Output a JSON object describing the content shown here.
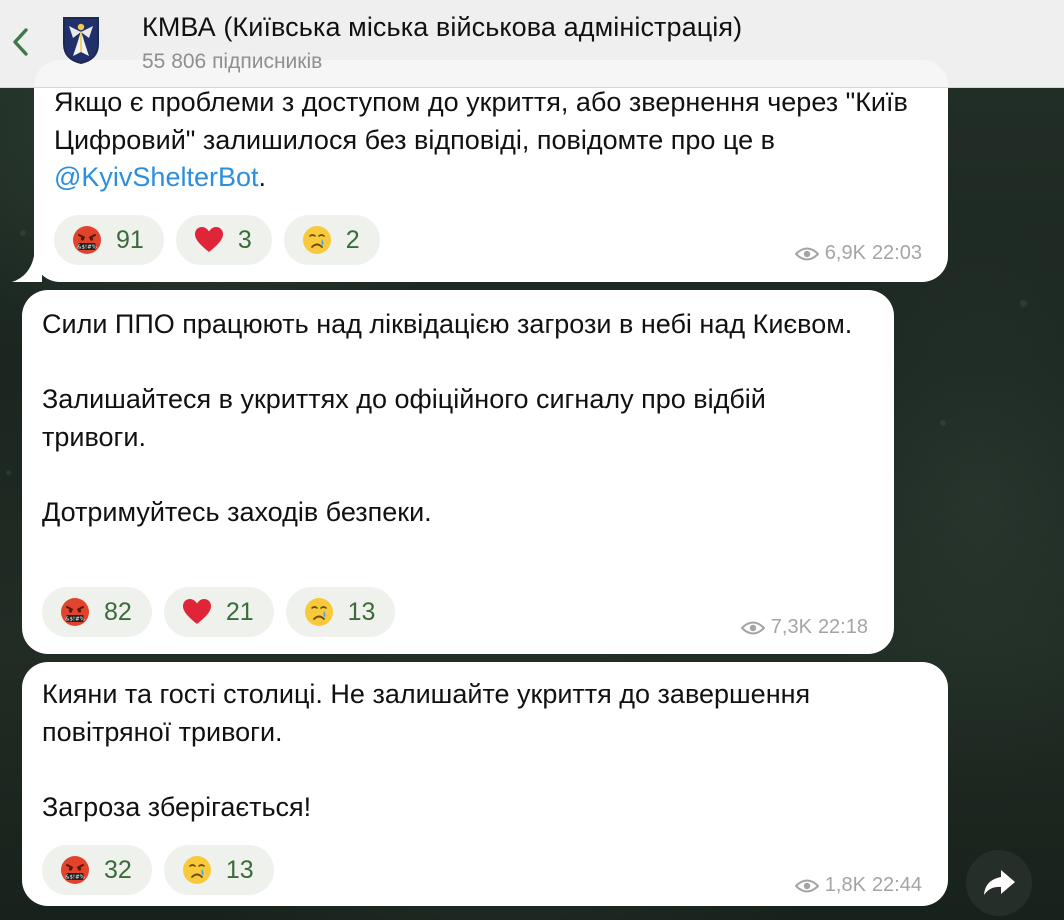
{
  "header": {
    "title": "КМВА (Київська міська військова адміністрація)",
    "subscribers": "55 806 підписників"
  },
  "messages": [
    {
      "paragraphs": [
        [
          "Якщо є проблеми з доступом до укриття, або звернення через \"Київ Цифровий\" залишилося без відповіді, повідомте про це в ",
          "@KyivShelterBot",
          "."
        ]
      ],
      "reactions": [
        {
          "emoji": "angry-swearing-face",
          "count": "91"
        },
        {
          "emoji": "red-heart",
          "count": "3"
        },
        {
          "emoji": "crying-face",
          "count": "2"
        }
      ],
      "views": "6,9K",
      "time": "22:03"
    },
    {
      "paragraphs": [
        "Сили ППО працюють над ліквідацією загрози в небі над Києвом.",
        "Залишайтеся в укриттях до офіційного сигналу про відбій тривоги.",
        "Дотримуйтесь заходів безпеки."
      ],
      "reactions": [
        {
          "emoji": "angry-swearing-face",
          "count": "82"
        },
        {
          "emoji": "red-heart",
          "count": "21"
        },
        {
          "emoji": "crying-face",
          "count": "13"
        }
      ],
      "views": "7,3K",
      "time": "22:18"
    },
    {
      "paragraphs": [
        "Кияни та гості столиці. Не залишайте укриття до завершення повітряної тривоги.",
        "Загроза зберігається!"
      ],
      "reactions": [
        {
          "emoji": "angry-swearing-face",
          "count": "32"
        },
        {
          "emoji": "crying-face",
          "count": "13"
        }
      ],
      "views": "1,8K",
      "time": "22:44"
    }
  ],
  "colors": {
    "header_bg": "#f6f6f6",
    "bubble_bg": "#ffffff",
    "link": "#2b8fde",
    "reaction_bg": "#eef1ec",
    "reaction_count": "#3b6b3b",
    "meta": "#a4a4a4",
    "back_chevron": "#3c7a4a"
  }
}
